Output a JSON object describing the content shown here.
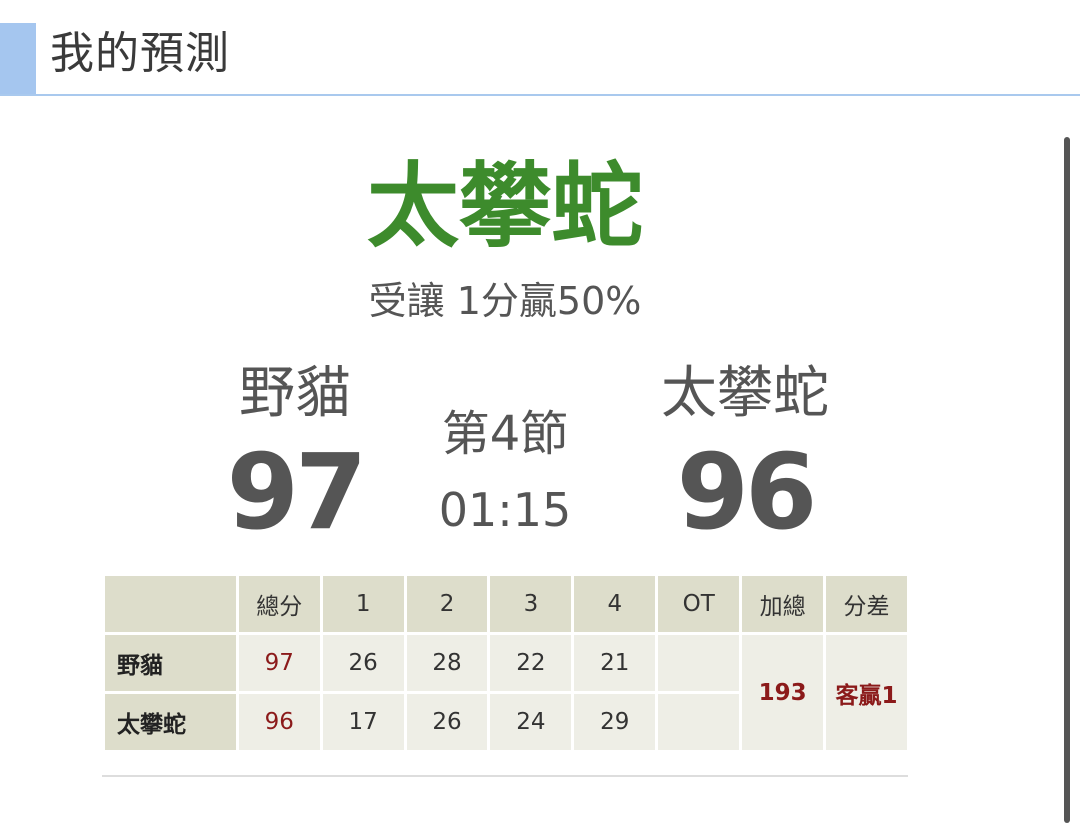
{
  "header": {
    "title": "我的預測"
  },
  "prediction": {
    "team": "太攀蛇",
    "line": "受讓 1分贏50%"
  },
  "game": {
    "home": {
      "name": "野貓",
      "score": "97"
    },
    "away": {
      "name": "太攀蛇",
      "score": "96"
    },
    "period": "第4節",
    "clock": "01:15"
  },
  "boxscore": {
    "headers": [
      "",
      "總分",
      "1",
      "2",
      "3",
      "4",
      "OT",
      "加總",
      "分差"
    ],
    "rows": [
      {
        "team": "野貓",
        "total": "97",
        "q": [
          "26",
          "28",
          "22",
          "21"
        ],
        "ot": ""
      },
      {
        "team": "太攀蛇",
        "total": "96",
        "q": [
          "17",
          "26",
          "24",
          "29"
        ],
        "ot": ""
      }
    ],
    "sum": "193",
    "diff": "客贏1"
  }
}
